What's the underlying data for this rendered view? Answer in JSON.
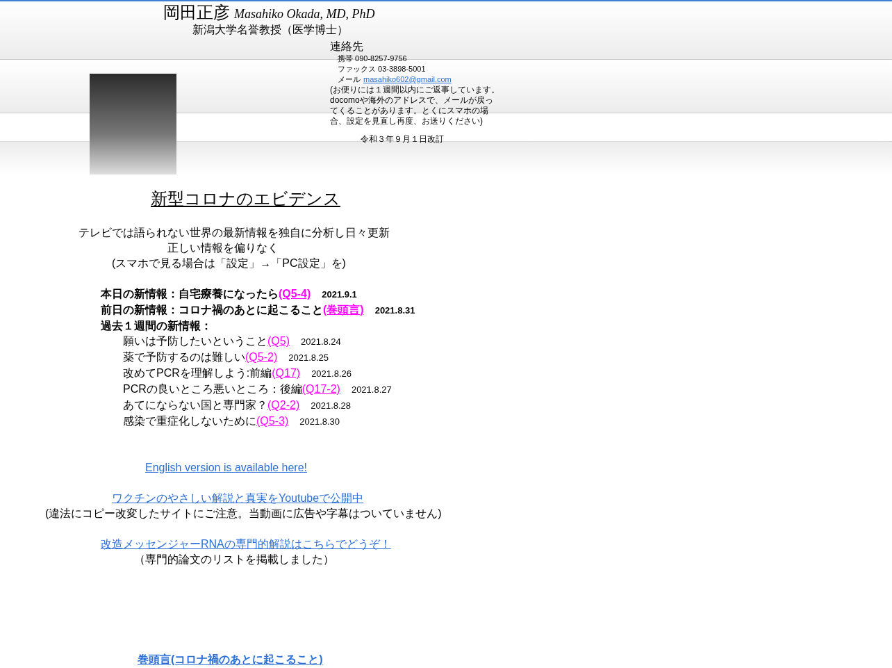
{
  "header": {
    "name_ja": "岡田正彦",
    "name_en": "Masahiko Okada, MD, PhD",
    "affiliation": "新潟大学名誉教授（医学博士）",
    "contact": {
      "heading": "連絡先",
      "mobile": "携帯 090-8257-9756",
      "fax": "ファックス 03-3898-5001",
      "email_label": "メール",
      "email": "masahiko602@gmail.com",
      "note": "(お便りには１週間以内にご返事しています。docomoや海外のアドレスで、メールが戻ってくることがあります。とくにスマホの場合、設定を見直し再度、お送りください)"
    },
    "revised": "令和３年９月１日改訂"
  },
  "title": "新型コロナのエビデンス",
  "intro": [
    "テレビでは語られない世界の最新情報を独自に分析し日々更新",
    "正しい情報を偏りなく",
    "(スマホで見る場合は「設定」→「PC設定」を)"
  ],
  "news": [
    {
      "kind": "headline",
      "text": "本日の新情報：自宅療養になったら",
      "link": "(Q5-4)",
      "date": "2021.9.1"
    },
    {
      "kind": "headline",
      "text": "前日の新情報：コロナ禍のあとに起こること",
      "link": "(巻頭言)",
      "date": "2021.8.31"
    },
    {
      "kind": "heading",
      "text": "過去１週間の新情報："
    },
    {
      "kind": "item",
      "text": "願いは予防したいということ",
      "link": "(Q5)",
      "date": "2021.8.24"
    },
    {
      "kind": "item",
      "text": "薬で予防するのは難しい",
      "link": "(Q5-2)",
      "date": "2021.8.25"
    },
    {
      "kind": "item",
      "text": "改めてPCRを理解しよう:前編",
      "link": "(Q17)",
      "date": "2021.8.26"
    },
    {
      "kind": "item",
      "text": "PCRの良いところ悪いところ：後編",
      "link": "(Q17-2)",
      "date": "2021.8.27"
    },
    {
      "kind": "item",
      "text": "あてにならない国と専門家？",
      "link": "(Q2-2)",
      "date": "2021.8.28"
    },
    {
      "kind": "item",
      "text": "感染で重症化しないために",
      "link": "(Q5-3)",
      "date": "2021.8.30"
    }
  ],
  "links": [
    {
      "kind": "link",
      "text": "English version is available here!"
    },
    {
      "kind": "link",
      "text": "ワクチンのやさしい解説と真実をYoutubeで公開中"
    },
    {
      "kind": "note",
      "text": "(違法にコピー改変したサイトにご注意。当動画に広告や字幕はついていません)"
    },
    {
      "kind": "link",
      "text": "改造メッセンジャーRNAの専門的解説はこちらでどうぞ！"
    },
    {
      "kind": "note",
      "text": "（専門的論文のリストを掲載しました）"
    },
    {
      "kind": "bold-link",
      "text": "巻頭言(コロナ禍のあとに起こること)"
    }
  ]
}
